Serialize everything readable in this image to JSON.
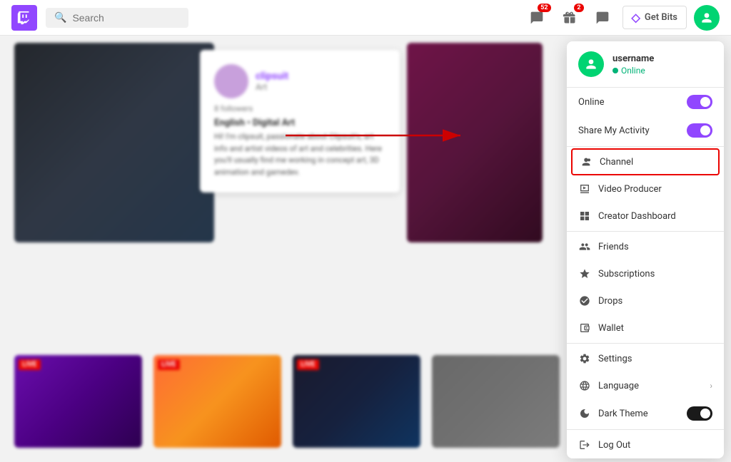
{
  "nav": {
    "logo_char": "♦",
    "search_placeholder": "Search",
    "notification_count": "52",
    "gift_count": "2",
    "get_bits_label": "Get Bits",
    "bits_icon": "◇"
  },
  "dropdown": {
    "username": "username",
    "status_label": "Online",
    "online_label": "Online",
    "share_label": "Share My Activity",
    "channel_label": "Channel",
    "video_producer_label": "Video Producer",
    "creator_dashboard_label": "Creator Dashboard",
    "friends_label": "Friends",
    "subscriptions_label": "Subscriptions",
    "drops_label": "Drops",
    "wallet_label": "Wallet",
    "settings_label": "Settings",
    "language_label": "Language",
    "dark_theme_label": "Dark Theme",
    "logout_label": "Log Out"
  },
  "popup": {
    "username": "clipsuit",
    "role": "Art",
    "followers": "8 followers",
    "stream_title": "English • Digital Art",
    "description": "Hi! I'm clipsuit, passionate about Clipsuit's, art info and artist videos of art and celebrities. Here you'll usually find me working in concept art, 3D animation and gamedev."
  },
  "streams": {
    "live_badge": "LIVE"
  }
}
